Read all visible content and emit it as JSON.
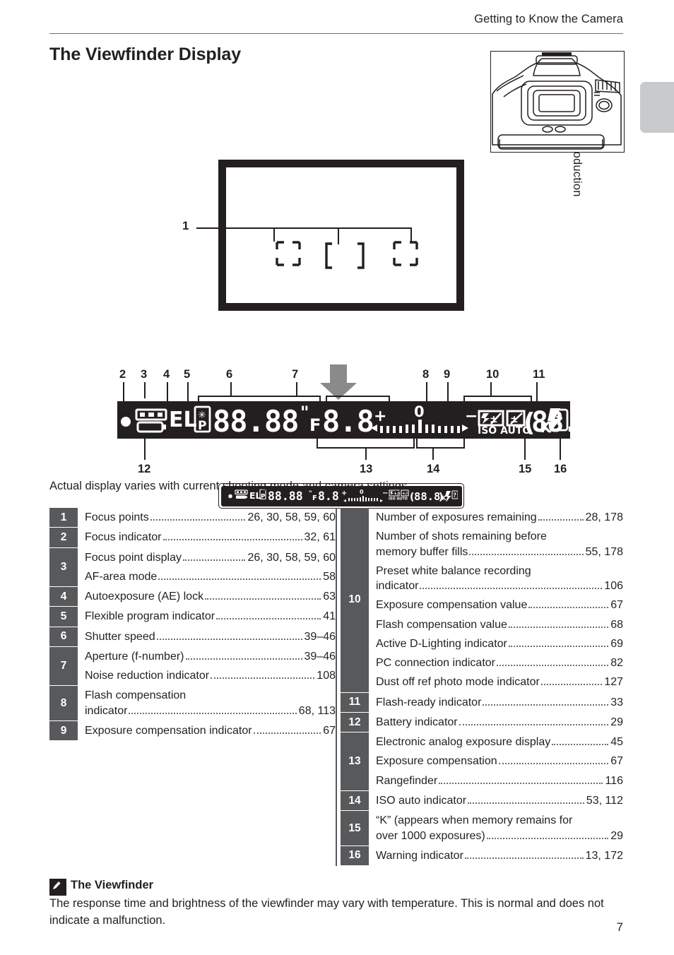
{
  "header": {
    "running_head": "Getting to Know the Camera",
    "side_tab_label": "Introduction"
  },
  "title": "The Viewfinder Display",
  "caption": "Actual display varies with current shooting mode and camera settings.",
  "page_number": "7",
  "callouts": {
    "one": "1",
    "top_row": [
      "2",
      "3",
      "4",
      "5",
      "6",
      "7",
      "8",
      "9",
      "10",
      "11"
    ],
    "bottom_row": [
      "12",
      "13",
      "14",
      "15",
      "16"
    ]
  },
  "viewfinder_icons": {
    "focus_indicator": "●",
    "af_area_mode": "af-area-bracket-icon",
    "battery": "battery-icon",
    "ae_lock": "EL",
    "flexible_program": "P",
    "shutter_speed": "88.88\"",
    "aperture_prefix": "F",
    "aperture": "8.8",
    "plus": "+",
    "zero": "0",
    "minus": "−",
    "flash_comp": "flash-compensation-icon",
    "exposure_comp": "exposure-compensation-icon",
    "iso_auto": "ISO AUTO",
    "frame_count": "888",
    "k_symbol": "K",
    "flash_ready": "flash-ready-icon",
    "warning": "?"
  },
  "table_left": [
    {
      "num": "1",
      "rows": [
        {
          "label": "Focus points",
          "page": "26, 30, 58, 59, 60"
        }
      ]
    },
    {
      "num": "2",
      "rows": [
        {
          "label": "Focus indicator",
          "page": "32, 61"
        }
      ]
    },
    {
      "num": "3",
      "rows": [
        {
          "label": "Focus point display",
          "page": "26, 30, 58, 59, 60"
        },
        {
          "label": "AF-area mode",
          "page": "58"
        }
      ]
    },
    {
      "num": "4",
      "rows": [
        {
          "label": "Autoexposure (AE) lock",
          "page": "63"
        }
      ]
    },
    {
      "num": "5",
      "rows": [
        {
          "label": "Flexible program indicator",
          "page": "41"
        }
      ]
    },
    {
      "num": "6",
      "rows": [
        {
          "label": "Shutter speed",
          "page": "39–46"
        }
      ]
    },
    {
      "num": "7",
      "rows": [
        {
          "label": "Aperture (f-number)",
          "page": "39–46"
        },
        {
          "label": "Noise reduction indicator",
          "page": "108"
        }
      ]
    },
    {
      "num": "8",
      "rows": [
        {
          "label": "Flash compensation",
          "label2": "indicator",
          "page": "68, 113",
          "wrap": true
        }
      ]
    },
    {
      "num": "9",
      "rows": [
        {
          "label": "Exposure compensation indicator",
          "page": "67"
        }
      ]
    }
  ],
  "table_right": [
    {
      "num": "10",
      "rows": [
        {
          "label": "Number of exposures remaining",
          "page": "28, 178"
        },
        {
          "label": "Number of shots remaining before",
          "label2": "memory buffer fills",
          "page": "55, 178",
          "wrap": true
        },
        {
          "label": "Preset white balance recording",
          "label2": "indicator",
          "page": "106",
          "wrap": true
        },
        {
          "label": "Exposure compensation value",
          "page": "67"
        },
        {
          "label": "Flash compensation value",
          "page": "68"
        },
        {
          "label": "Active D-Lighting indicator",
          "page": "69"
        },
        {
          "label": "PC connection indicator",
          "page": "82"
        },
        {
          "label": "Dust off ref photo mode indicator",
          "page": "127"
        }
      ]
    },
    {
      "num": "11",
      "rows": [
        {
          "label": "Flash-ready indicator",
          "page": "33"
        }
      ]
    },
    {
      "num": "12",
      "rows": [
        {
          "label": "Battery indicator",
          "page": "29"
        }
      ]
    },
    {
      "num": "13",
      "rows": [
        {
          "label": "Electronic analog exposure display",
          "page": "45"
        },
        {
          "label": "Exposure compensation",
          "page": "67"
        },
        {
          "label": "Rangefinder",
          "page": "116"
        }
      ]
    },
    {
      "num": "14",
      "rows": [
        {
          "label": "ISO auto indicator",
          "page": "53, 112"
        }
      ]
    },
    {
      "num": "15",
      "rows": [
        {
          "label": "“K” (appears when memory remains for",
          "label2": "over 1000 exposures)",
          "page": "29",
          "wrap": true
        }
      ]
    },
    {
      "num": "16",
      "rows": [
        {
          "label": "Warning indicator",
          "page": "13, 172"
        }
      ]
    }
  ],
  "note": {
    "title": "The Viewfinder",
    "body": "The response time and brightness of the viewfinder may vary with temperature. This is normal and does not indicate a malfunction."
  },
  "colors": {
    "ink": "#231f20",
    "badge_gray": "#58595b",
    "tab_gray": "#c9cacb",
    "arrow_gray": "#8a8a8a",
    "dots_gray": "#6d6e71"
  }
}
